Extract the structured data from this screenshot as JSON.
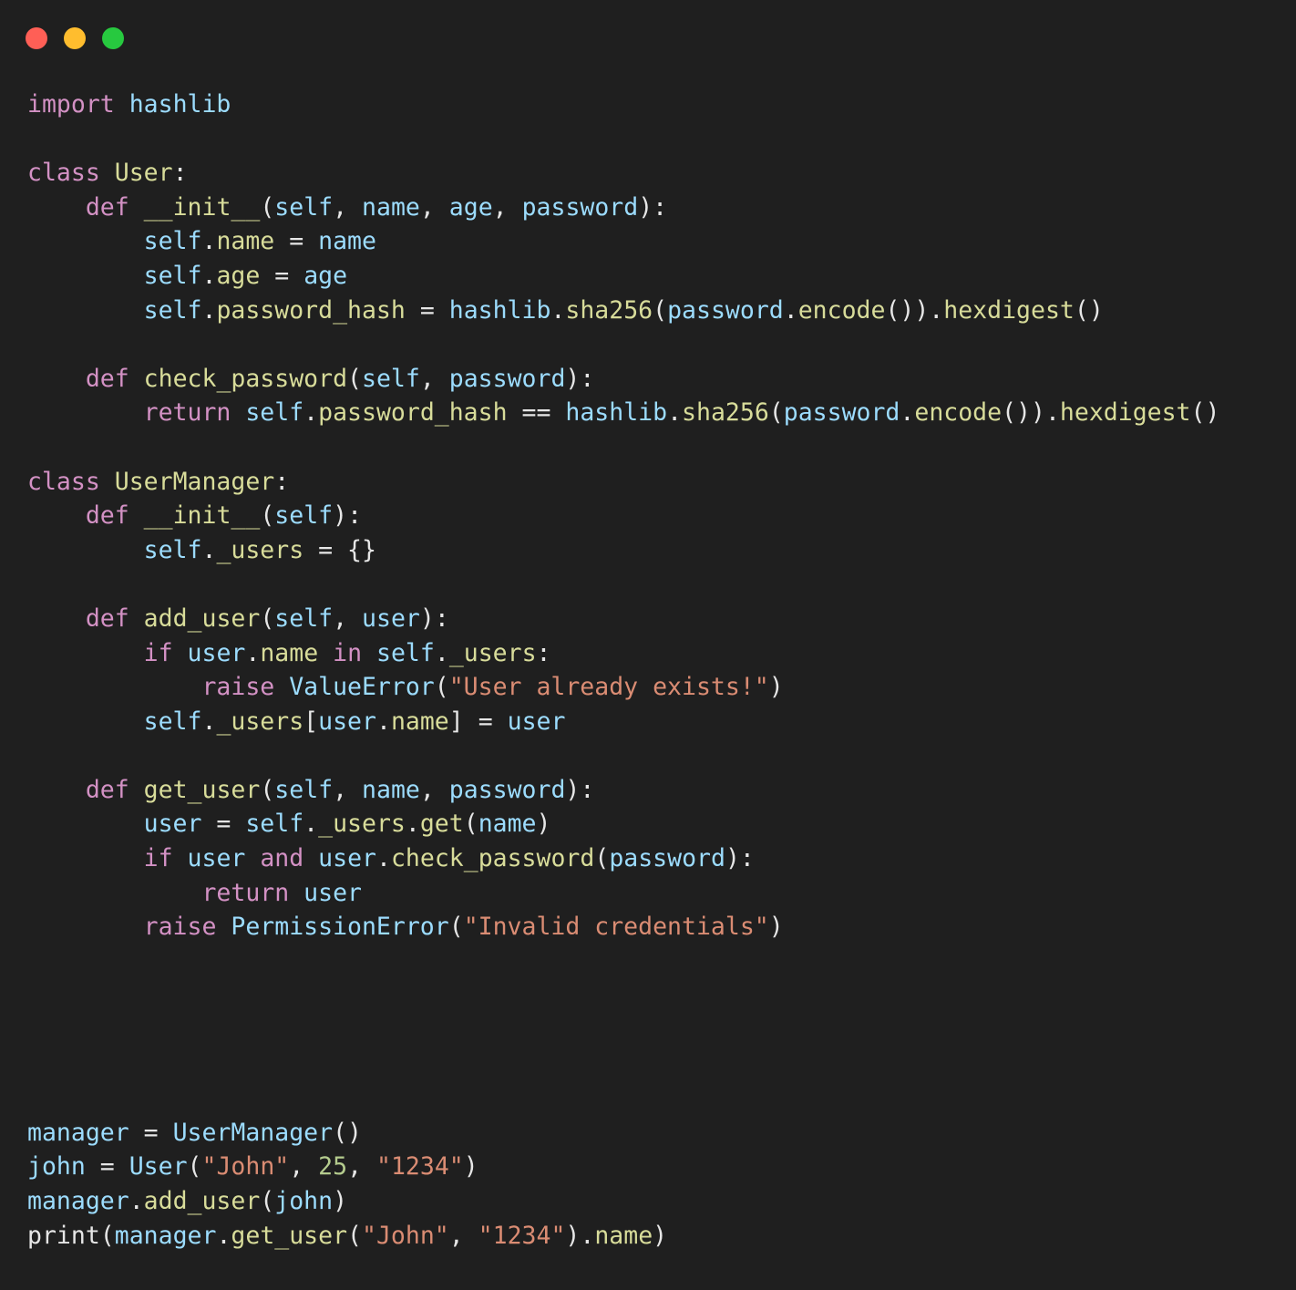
{
  "window": {
    "title": "",
    "background_color": "#1f1f1f",
    "traffic_lights": [
      {
        "name": "close",
        "color": "#ff5f56"
      },
      {
        "name": "minimize",
        "color": "#ffbd2e"
      },
      {
        "name": "maximize",
        "color": "#27c93f"
      }
    ]
  },
  "editor": {
    "language": "python",
    "font_size_px": 26.5,
    "line_height_px": 37.6,
    "theme": {
      "background": "#1f1f1f",
      "default_text": "#e8e8e8",
      "keyword": "#d391c4",
      "name": "#d8dc9a",
      "variable": "#9cdcfe",
      "string": "#da8c73",
      "number": "#b5cc8e",
      "operator": "#e6e6e6"
    },
    "code_plain": "import hashlib\n\nclass User:\n    def __init__(self, name, age, password):\n        self.name = name\n        self.age = age\n        self.password_hash = hashlib.sha256(password.encode()).hexdigest()\n\n    def check_password(self, password):\n        return self.password_hash == hashlib.sha256(password.encode()).hexdigest()\n\nclass UserManager:\n    def __init__(self):\n        self._users = {}\n\n    def add_user(self, user):\n        if user.name in self._users:\n            raise ValueError(\"User already exists!\")\n        self._users[user.name] = user\n\n    def get_user(self, name, password):\n        user = self._users.get(name)\n        if user and user.check_password(password):\n            return user\n        raise PermissionError(\"Invalid credentials\")\n\n\n\n\n\nmanager = UserManager()\njohn = User(\"John\", 25, \"1234\")\nmanager.add_user(john)\nprint(manager.get_user(\"John\", \"1234\").name)",
    "lines": [
      {
        "n": 1,
        "tokens": [
          {
            "t": "import",
            "c": "kw"
          },
          {
            "t": " ",
            "c": "pl"
          },
          {
            "t": "hashlib",
            "c": "var"
          }
        ]
      },
      {
        "n": 2,
        "tokens": []
      },
      {
        "n": 3,
        "tokens": [
          {
            "t": "class",
            "c": "kw"
          },
          {
            "t": " ",
            "c": "pl"
          },
          {
            "t": "User",
            "c": "name"
          },
          {
            "t": ":",
            "c": "punc"
          }
        ]
      },
      {
        "n": 4,
        "tokens": [
          {
            "t": "    ",
            "c": "pl"
          },
          {
            "t": "def",
            "c": "kw"
          },
          {
            "t": " ",
            "c": "pl"
          },
          {
            "t": "__init__",
            "c": "name"
          },
          {
            "t": "(",
            "c": "punc"
          },
          {
            "t": "self",
            "c": "var"
          },
          {
            "t": ", ",
            "c": "punc"
          },
          {
            "t": "name",
            "c": "var"
          },
          {
            "t": ", ",
            "c": "punc"
          },
          {
            "t": "age",
            "c": "var"
          },
          {
            "t": ", ",
            "c": "punc"
          },
          {
            "t": "password",
            "c": "var"
          },
          {
            "t": "):",
            "c": "punc"
          }
        ]
      },
      {
        "n": 5,
        "tokens": [
          {
            "t": "        ",
            "c": "pl"
          },
          {
            "t": "self",
            "c": "var"
          },
          {
            "t": ".",
            "c": "punc"
          },
          {
            "t": "name",
            "c": "name"
          },
          {
            "t": " = ",
            "c": "op"
          },
          {
            "t": "name",
            "c": "var"
          }
        ]
      },
      {
        "n": 6,
        "tokens": [
          {
            "t": "        ",
            "c": "pl"
          },
          {
            "t": "self",
            "c": "var"
          },
          {
            "t": ".",
            "c": "punc"
          },
          {
            "t": "age",
            "c": "name"
          },
          {
            "t": " = ",
            "c": "op"
          },
          {
            "t": "age",
            "c": "var"
          }
        ]
      },
      {
        "n": 7,
        "tokens": [
          {
            "t": "        ",
            "c": "pl"
          },
          {
            "t": "self",
            "c": "var"
          },
          {
            "t": ".",
            "c": "punc"
          },
          {
            "t": "password_hash",
            "c": "name"
          },
          {
            "t": " = ",
            "c": "op"
          },
          {
            "t": "hashlib",
            "c": "var"
          },
          {
            "t": ".",
            "c": "punc"
          },
          {
            "t": "sha256",
            "c": "name"
          },
          {
            "t": "(",
            "c": "punc"
          },
          {
            "t": "password",
            "c": "var"
          },
          {
            "t": ".",
            "c": "punc"
          },
          {
            "t": "encode",
            "c": "name"
          },
          {
            "t": "()).",
            "c": "punc"
          },
          {
            "t": "hexdigest",
            "c": "name"
          },
          {
            "t": "()",
            "c": "punc"
          }
        ]
      },
      {
        "n": 8,
        "tokens": []
      },
      {
        "n": 9,
        "tokens": [
          {
            "t": "    ",
            "c": "pl"
          },
          {
            "t": "def",
            "c": "kw"
          },
          {
            "t": " ",
            "c": "pl"
          },
          {
            "t": "check_password",
            "c": "name"
          },
          {
            "t": "(",
            "c": "punc"
          },
          {
            "t": "self",
            "c": "var"
          },
          {
            "t": ", ",
            "c": "punc"
          },
          {
            "t": "password",
            "c": "var"
          },
          {
            "t": "):",
            "c": "punc"
          }
        ]
      },
      {
        "n": 10,
        "tokens": [
          {
            "t": "        ",
            "c": "pl"
          },
          {
            "t": "return",
            "c": "kw"
          },
          {
            "t": " ",
            "c": "pl"
          },
          {
            "t": "self",
            "c": "var"
          },
          {
            "t": ".",
            "c": "punc"
          },
          {
            "t": "password_hash",
            "c": "name"
          },
          {
            "t": " == ",
            "c": "op"
          },
          {
            "t": "hashlib",
            "c": "var"
          },
          {
            "t": ".",
            "c": "punc"
          },
          {
            "t": "sha256",
            "c": "name"
          },
          {
            "t": "(",
            "c": "punc"
          },
          {
            "t": "password",
            "c": "var"
          },
          {
            "t": ".",
            "c": "punc"
          },
          {
            "t": "encode",
            "c": "name"
          },
          {
            "t": "()).",
            "c": "punc"
          },
          {
            "t": "hexdigest",
            "c": "name"
          },
          {
            "t": "()",
            "c": "punc"
          }
        ]
      },
      {
        "n": 11,
        "tokens": []
      },
      {
        "n": 12,
        "tokens": [
          {
            "t": "class",
            "c": "kw"
          },
          {
            "t": " ",
            "c": "pl"
          },
          {
            "t": "UserManager",
            "c": "name"
          },
          {
            "t": ":",
            "c": "punc"
          }
        ]
      },
      {
        "n": 13,
        "tokens": [
          {
            "t": "    ",
            "c": "pl"
          },
          {
            "t": "def",
            "c": "kw"
          },
          {
            "t": " ",
            "c": "pl"
          },
          {
            "t": "__init__",
            "c": "name"
          },
          {
            "t": "(",
            "c": "punc"
          },
          {
            "t": "self",
            "c": "var"
          },
          {
            "t": "):",
            "c": "punc"
          }
        ]
      },
      {
        "n": 14,
        "tokens": [
          {
            "t": "        ",
            "c": "pl"
          },
          {
            "t": "self",
            "c": "var"
          },
          {
            "t": ".",
            "c": "punc"
          },
          {
            "t": "_users",
            "c": "name"
          },
          {
            "t": " = ",
            "c": "op"
          },
          {
            "t": "{}",
            "c": "punc"
          }
        ]
      },
      {
        "n": 15,
        "tokens": []
      },
      {
        "n": 16,
        "tokens": [
          {
            "t": "    ",
            "c": "pl"
          },
          {
            "t": "def",
            "c": "kw"
          },
          {
            "t": " ",
            "c": "pl"
          },
          {
            "t": "add_user",
            "c": "name"
          },
          {
            "t": "(",
            "c": "punc"
          },
          {
            "t": "self",
            "c": "var"
          },
          {
            "t": ", ",
            "c": "punc"
          },
          {
            "t": "user",
            "c": "var"
          },
          {
            "t": "):",
            "c": "punc"
          }
        ]
      },
      {
        "n": 17,
        "tokens": [
          {
            "t": "        ",
            "c": "pl"
          },
          {
            "t": "if",
            "c": "kw"
          },
          {
            "t": " ",
            "c": "pl"
          },
          {
            "t": "user",
            "c": "var"
          },
          {
            "t": ".",
            "c": "punc"
          },
          {
            "t": "name",
            "c": "name"
          },
          {
            "t": " ",
            "c": "pl"
          },
          {
            "t": "in",
            "c": "kw"
          },
          {
            "t": " ",
            "c": "pl"
          },
          {
            "t": "self",
            "c": "var"
          },
          {
            "t": ".",
            "c": "punc"
          },
          {
            "t": "_users",
            "c": "name"
          },
          {
            "t": ":",
            "c": "punc"
          }
        ]
      },
      {
        "n": 18,
        "tokens": [
          {
            "t": "            ",
            "c": "pl"
          },
          {
            "t": "raise",
            "c": "kw"
          },
          {
            "t": " ",
            "c": "pl"
          },
          {
            "t": "ValueError",
            "c": "var"
          },
          {
            "t": "(",
            "c": "punc"
          },
          {
            "t": "\"User already exists!\"",
            "c": "str"
          },
          {
            "t": ")",
            "c": "punc"
          }
        ]
      },
      {
        "n": 19,
        "tokens": [
          {
            "t": "        ",
            "c": "pl"
          },
          {
            "t": "self",
            "c": "var"
          },
          {
            "t": ".",
            "c": "punc"
          },
          {
            "t": "_users",
            "c": "name"
          },
          {
            "t": "[",
            "c": "punc"
          },
          {
            "t": "user",
            "c": "var"
          },
          {
            "t": ".",
            "c": "punc"
          },
          {
            "t": "name",
            "c": "name"
          },
          {
            "t": "]",
            "c": "punc"
          },
          {
            "t": " = ",
            "c": "op"
          },
          {
            "t": "user",
            "c": "var"
          }
        ]
      },
      {
        "n": 20,
        "tokens": []
      },
      {
        "n": 21,
        "tokens": [
          {
            "t": "    ",
            "c": "pl"
          },
          {
            "t": "def",
            "c": "kw"
          },
          {
            "t": " ",
            "c": "pl"
          },
          {
            "t": "get_user",
            "c": "name"
          },
          {
            "t": "(",
            "c": "punc"
          },
          {
            "t": "self",
            "c": "var"
          },
          {
            "t": ", ",
            "c": "punc"
          },
          {
            "t": "name",
            "c": "var"
          },
          {
            "t": ", ",
            "c": "punc"
          },
          {
            "t": "password",
            "c": "var"
          },
          {
            "t": "):",
            "c": "punc"
          }
        ]
      },
      {
        "n": 22,
        "tokens": [
          {
            "t": "        ",
            "c": "pl"
          },
          {
            "t": "user",
            "c": "var"
          },
          {
            "t": " = ",
            "c": "op"
          },
          {
            "t": "self",
            "c": "var"
          },
          {
            "t": ".",
            "c": "punc"
          },
          {
            "t": "_users",
            "c": "name"
          },
          {
            "t": ".",
            "c": "punc"
          },
          {
            "t": "get",
            "c": "name"
          },
          {
            "t": "(",
            "c": "punc"
          },
          {
            "t": "name",
            "c": "var"
          },
          {
            "t": ")",
            "c": "punc"
          }
        ]
      },
      {
        "n": 23,
        "tokens": [
          {
            "t": "        ",
            "c": "pl"
          },
          {
            "t": "if",
            "c": "kw"
          },
          {
            "t": " ",
            "c": "pl"
          },
          {
            "t": "user",
            "c": "var"
          },
          {
            "t": " ",
            "c": "pl"
          },
          {
            "t": "and",
            "c": "kw"
          },
          {
            "t": " ",
            "c": "pl"
          },
          {
            "t": "user",
            "c": "var"
          },
          {
            "t": ".",
            "c": "punc"
          },
          {
            "t": "check_password",
            "c": "name"
          },
          {
            "t": "(",
            "c": "punc"
          },
          {
            "t": "password",
            "c": "var"
          },
          {
            "t": "):",
            "c": "punc"
          }
        ]
      },
      {
        "n": 24,
        "tokens": [
          {
            "t": "            ",
            "c": "pl"
          },
          {
            "t": "return",
            "c": "kw"
          },
          {
            "t": " ",
            "c": "pl"
          },
          {
            "t": "user",
            "c": "var"
          }
        ]
      },
      {
        "n": 25,
        "tokens": [
          {
            "t": "        ",
            "c": "pl"
          },
          {
            "t": "raise",
            "c": "kw"
          },
          {
            "t": " ",
            "c": "pl"
          },
          {
            "t": "PermissionError",
            "c": "var"
          },
          {
            "t": "(",
            "c": "punc"
          },
          {
            "t": "\"Invalid credentials\"",
            "c": "str"
          },
          {
            "t": ")",
            "c": "punc"
          }
        ]
      },
      {
        "n": 26,
        "tokens": []
      },
      {
        "n": 27,
        "tokens": []
      },
      {
        "n": 28,
        "tokens": []
      },
      {
        "n": 29,
        "tokens": []
      },
      {
        "n": 30,
        "tokens": []
      },
      {
        "n": 31,
        "tokens": [
          {
            "t": "manager",
            "c": "var"
          },
          {
            "t": " = ",
            "c": "op"
          },
          {
            "t": "UserManager",
            "c": "var"
          },
          {
            "t": "()",
            "c": "punc"
          }
        ]
      },
      {
        "n": 32,
        "tokens": [
          {
            "t": "john",
            "c": "var"
          },
          {
            "t": " = ",
            "c": "op"
          },
          {
            "t": "User",
            "c": "var"
          },
          {
            "t": "(",
            "c": "punc"
          },
          {
            "t": "\"John\"",
            "c": "str"
          },
          {
            "t": ", ",
            "c": "punc"
          },
          {
            "t": "25",
            "c": "num"
          },
          {
            "t": ", ",
            "c": "punc"
          },
          {
            "t": "\"1234\"",
            "c": "str"
          },
          {
            "t": ")",
            "c": "punc"
          }
        ]
      },
      {
        "n": 33,
        "tokens": [
          {
            "t": "manager",
            "c": "var"
          },
          {
            "t": ".",
            "c": "punc"
          },
          {
            "t": "add_user",
            "c": "name"
          },
          {
            "t": "(",
            "c": "punc"
          },
          {
            "t": "john",
            "c": "var"
          },
          {
            "t": ")",
            "c": "punc"
          }
        ]
      },
      {
        "n": 34,
        "tokens": [
          {
            "t": "print",
            "c": "pl"
          },
          {
            "t": "(",
            "c": "punc"
          },
          {
            "t": "manager",
            "c": "var"
          },
          {
            "t": ".",
            "c": "punc"
          },
          {
            "t": "get_user",
            "c": "name"
          },
          {
            "t": "(",
            "c": "punc"
          },
          {
            "t": "\"John\"",
            "c": "str"
          },
          {
            "t": ", ",
            "c": "punc"
          },
          {
            "t": "\"1234\"",
            "c": "str"
          },
          {
            "t": ").",
            "c": "punc"
          },
          {
            "t": "name",
            "c": "name"
          },
          {
            "t": ")",
            "c": "punc"
          }
        ]
      }
    ]
  }
}
